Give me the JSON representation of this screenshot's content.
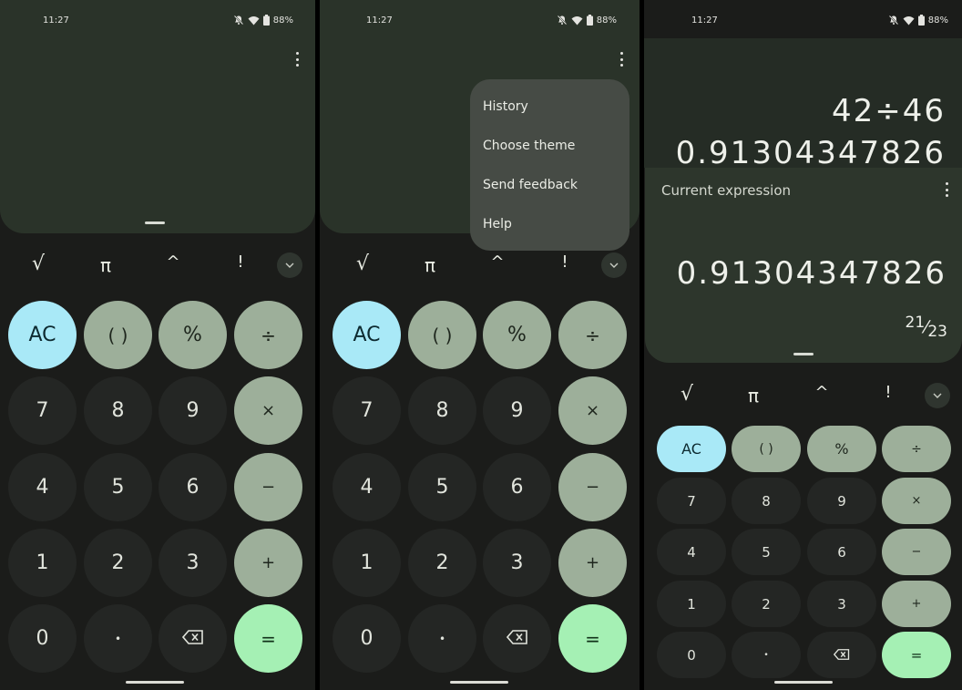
{
  "status": {
    "time": "11:27",
    "battery": "88%"
  },
  "icons": {
    "mute": "bell-off-icon",
    "wifi": "wifi-icon",
    "battery": "battery-icon",
    "menu": "more-vert-icon",
    "backspace": "backspace-icon",
    "expand": "chevron-down-icon"
  },
  "colors": {
    "display_bg": "#2a3329",
    "op_key": "#9daf9a",
    "clear_key": "#a9e9f7",
    "equals_key": "#a5f0b4",
    "num_key": "#242624"
  },
  "scientific": [
    "√",
    "π",
    "^",
    "!"
  ],
  "keys": {
    "clear": "AC",
    "paren": "( )",
    "percent": "%",
    "divide": "÷",
    "seven": "7",
    "eight": "8",
    "nine": "9",
    "multiply": "×",
    "four": "4",
    "five": "5",
    "six": "6",
    "minus": "−",
    "one": "1",
    "two": "2",
    "three": "3",
    "plus": "+",
    "zero": "0",
    "decimal": "•",
    "equals": "="
  },
  "menu": {
    "history": "History",
    "theme": "Choose theme",
    "feedback": "Send feedback",
    "help": "Help"
  },
  "history": {
    "expression": "42÷46",
    "result": "0.91304347826"
  },
  "current": {
    "label": "Current expression",
    "value": "0.91304347826",
    "frac_num": "21",
    "frac_den": "23"
  }
}
